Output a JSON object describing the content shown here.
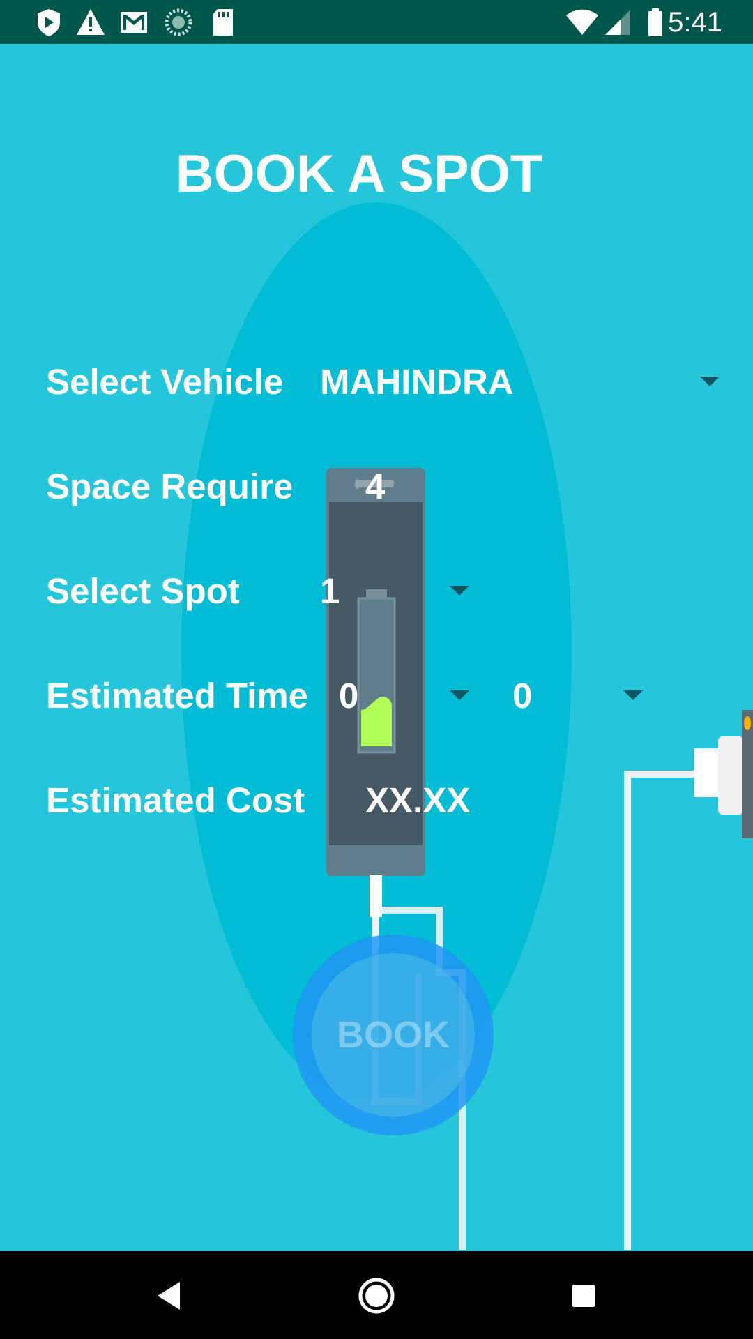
{
  "status_bar": {
    "time": "5:41",
    "left_icons": [
      "shield-icon",
      "warning-icon",
      "gmail-icon",
      "sync-icon",
      "sd-card-icon"
    ],
    "right_icons": [
      "wifi-icon",
      "signal-icon",
      "battery-icon"
    ]
  },
  "page": {
    "title": "BOOK A SPOT"
  },
  "form": {
    "vehicle": {
      "label": "Select Vehicle",
      "value": "MAHINDRA"
    },
    "space": {
      "label": "Space Require",
      "value": "4"
    },
    "spot": {
      "label": "Select Spot",
      "value": "1"
    },
    "time": {
      "label": "Estimated Time",
      "hours": "0",
      "minutes": "0"
    },
    "cost": {
      "label": "Estimated Cost",
      "value": "XX.XX"
    }
  },
  "book_button": {
    "label": "BOOK"
  },
  "nav_bar": {
    "buttons": [
      "back-icon",
      "home-icon",
      "recents-icon"
    ]
  },
  "colors": {
    "background": "#26c6da",
    "ellipse": "#00bcd4",
    "status_bar": "#00574b",
    "accent": "#2196f3",
    "battery_charge": "#b2ff59"
  }
}
